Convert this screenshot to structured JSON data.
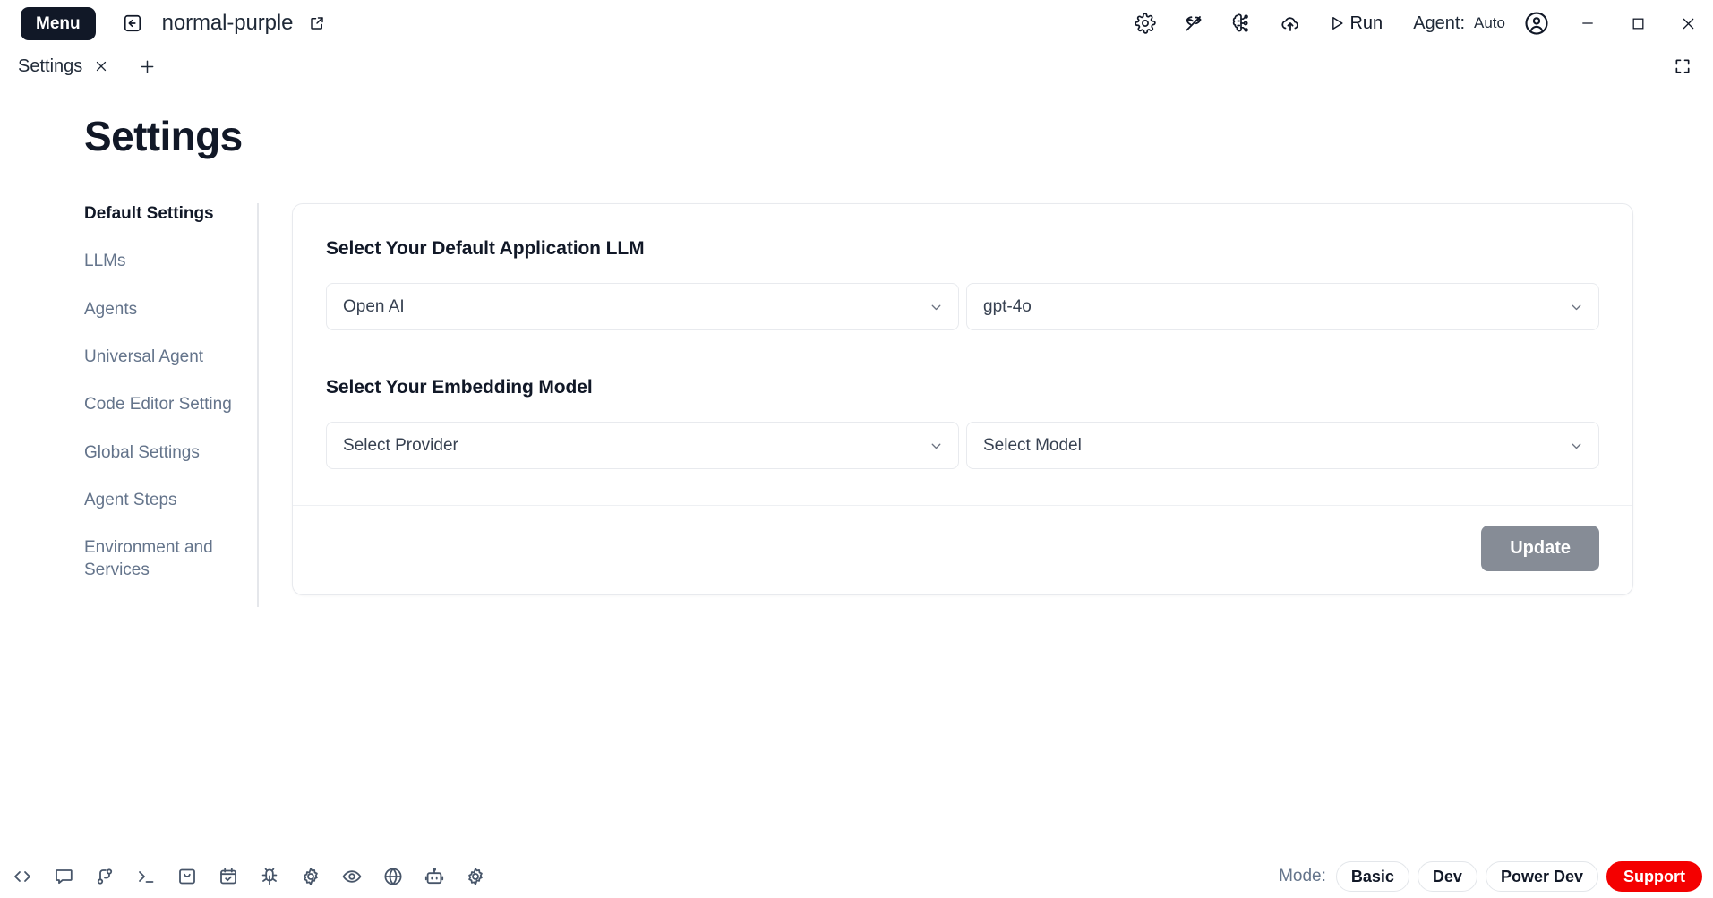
{
  "titlebar": {
    "menu_label": "Menu",
    "back_icon": "back-arrow-icon",
    "project_name": "normal-purple",
    "external_link_icon": "external-link-icon",
    "tool_icons": [
      {
        "name": "gear-icon",
        "title": "Settings"
      },
      {
        "name": "pickaxe-icon",
        "title": "Build"
      },
      {
        "name": "brain-circuit-icon",
        "title": "Brain"
      },
      {
        "name": "cloud-upload-icon",
        "title": "Deploy"
      }
    ],
    "run_label": "Run",
    "agent_label": "Agent:",
    "agent_value": "Auto",
    "account_icon": "account-circle-icon",
    "window_controls": {
      "minimize": "minimize-icon",
      "maximize": "maximize-icon",
      "close": "close-icon"
    }
  },
  "tabstrip": {
    "tabs": [
      {
        "label": "Settings",
        "active": true
      }
    ],
    "close_icon": "close-icon",
    "add_icon": "plus-icon",
    "fullscreen_icon": "fullscreen-icon"
  },
  "page": {
    "title": "Settings"
  },
  "sidebar": {
    "items": [
      {
        "label": "Default Settings",
        "active": true
      },
      {
        "label": "LLMs",
        "active": false
      },
      {
        "label": "Agents",
        "active": false
      },
      {
        "label": "Universal Agent",
        "active": false
      },
      {
        "label": "Code Editor Setting",
        "active": false
      },
      {
        "label": "Global Settings",
        "active": false
      },
      {
        "label": "Agent Steps",
        "active": false
      },
      {
        "label": "Environment and Services",
        "active": false
      }
    ]
  },
  "main": {
    "sections": [
      {
        "title": "Select Your Default Application LLM",
        "provider": {
          "value": "Open AI",
          "is_placeholder": false
        },
        "model": {
          "value": "gpt-4o",
          "is_placeholder": false
        }
      },
      {
        "title": "Select Your Embedding Model",
        "provider": {
          "value": "Select Provider",
          "is_placeholder": true
        },
        "model": {
          "value": "Select Model",
          "is_placeholder": true
        }
      }
    ],
    "update_label": "Update",
    "chevron_icon": "chevron-down-icon"
  },
  "statusbar": {
    "icons": [
      {
        "name": "code-brackets-icon"
      },
      {
        "name": "chat-bubble-icon"
      },
      {
        "name": "git-branch-icon"
      },
      {
        "name": "terminal-icon"
      },
      {
        "name": "inbox-icon"
      },
      {
        "name": "calendar-check-icon"
      },
      {
        "name": "bug-icon"
      },
      {
        "name": "gear-icon"
      },
      {
        "name": "eye-icon"
      },
      {
        "name": "globe-icon"
      },
      {
        "name": "robot-icon"
      },
      {
        "name": "gear-alt-icon"
      }
    ],
    "mode_label": "Mode:",
    "modes": [
      {
        "label": "Basic",
        "style": "default"
      },
      {
        "label": "Dev",
        "style": "default"
      },
      {
        "label": "Power Dev",
        "style": "default"
      },
      {
        "label": "Support",
        "style": "support"
      }
    ]
  },
  "colors": {
    "menu_bg": "#111827",
    "support_red": "#f40000",
    "update_gray": "#868c96",
    "muted_text": "#64748b",
    "border": "#e8eaee"
  }
}
